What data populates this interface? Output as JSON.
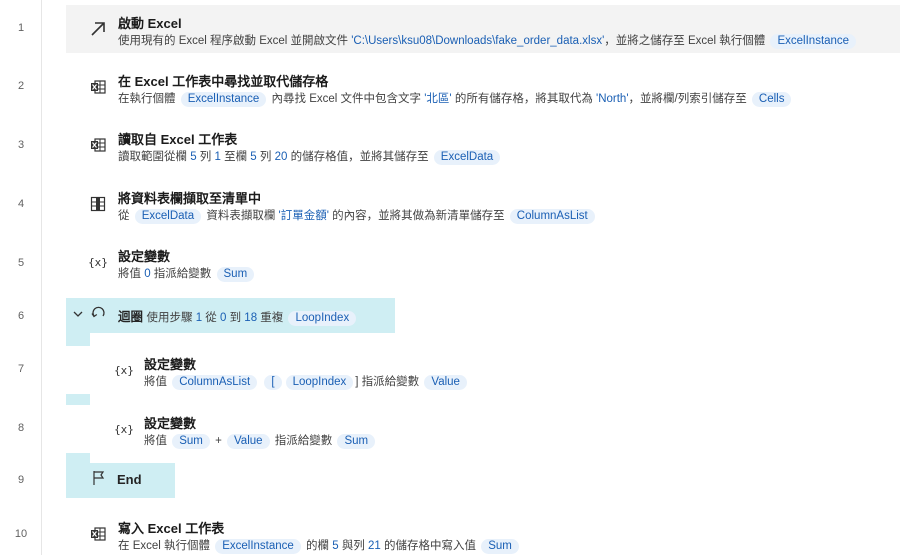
{
  "line_numbers": [
    "1",
    "2",
    "3",
    "4",
    "5",
    "6",
    "7",
    "8",
    "9",
    "10"
  ],
  "actions": {
    "a1": {
      "title": "啟動 Excel",
      "desc_pre": "使用現有的 Excel 程序啟動 Excel 並開啟文件 ",
      "path": "'C:\\Users\\ksu08\\Downloads\\fake_order_data.xlsx'",
      "desc_mid": "，並將之儲存至 Excel 執行個體 ",
      "var": "ExcelInstance"
    },
    "a2": {
      "title": "在 Excel 工作表中尋找並取代儲存格",
      "p1": "在執行個體 ",
      "var1": "ExcelInstance",
      "p2": " 內尋找 Excel 文件中包含文字 ",
      "find": "'北區'",
      "p3": " 的所有儲存格，將其取代為 ",
      "replace": "'North'",
      "p4": "，並將欄/列索引儲存至 ",
      "var2": "Cells"
    },
    "a3": {
      "title": "讀取自 Excel 工作表",
      "p1": "讀取範圍從欄 ",
      "n1": "5",
      "p2": " 列 ",
      "n2": "1",
      "p3": " 至欄 ",
      "n3": "5",
      "p4": " 列 ",
      "n4": "20",
      "p5": " 的儲存格值，並將其儲存至 ",
      "var": "ExcelData"
    },
    "a4": {
      "title": "將資料表欄擷取至清單中",
      "p1": "從 ",
      "var1": "ExcelData",
      "p2": " 資料表擷取欄 ",
      "col": "'訂單金額'",
      "p3": " 的內容，並將其做為新清單儲存至 ",
      "var2": "ColumnAsList"
    },
    "a5": {
      "icon": "{x}",
      "title": "設定變數",
      "p1": "將值 ",
      "n1": "0",
      "p2": " 指派給變數 ",
      "var": "Sum"
    },
    "a6": {
      "title": "迴圈",
      "p1": "使用步驟 ",
      "n1": "1",
      "p2": " 從 ",
      "n2": "0",
      "p3": " 到 ",
      "n3": "18",
      "p4": " 重複 ",
      "var": "LoopIndex"
    },
    "a7": {
      "icon": "{x}",
      "title": "設定變數",
      "p1": "將值 ",
      "var1": "ColumnAsList",
      "br1": "[",
      "var2": "LoopIndex",
      "br2": "]",
      "p2": " 指派給變數 ",
      "var3": "Value"
    },
    "a8": {
      "icon": "{x}",
      "title": "設定變數",
      "p1": "將值 ",
      "var1": "Sum",
      "op": "+",
      "var2": "Value",
      "p2": " 指派給變數 ",
      "var3": "Sum"
    },
    "a9": {
      "title": "End"
    },
    "a10": {
      "title": "寫入 Excel 工作表",
      "p1": "在 Excel 執行個體 ",
      "var1": "ExcelInstance",
      "p2": " 的欄 ",
      "n1": "5",
      "p3": " 與列 ",
      "n2": "21",
      "p4": " 的儲存格中寫入值 ",
      "var2": "Sum"
    }
  },
  "colors": {
    "loop_block": "#cfeef3",
    "token_bg": "#e8f1fb",
    "token_text": "#1a5fb4",
    "selected_row": "#f3f3f3"
  }
}
